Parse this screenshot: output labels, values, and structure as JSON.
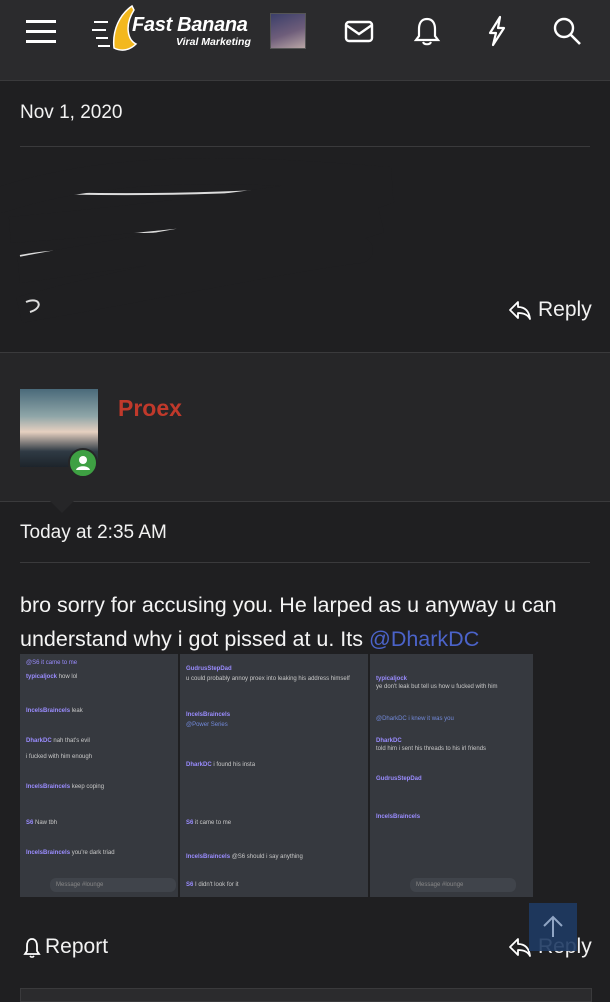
{
  "brand": {
    "name": "Fast Banana",
    "tagline": "Viral Marketing"
  },
  "icons": [
    "menu-icon",
    "avatar",
    "mail-icon",
    "bell-icon",
    "lightning-icon",
    "search-icon"
  ],
  "post1": {
    "date": "Nov 1, 2020",
    "reply_label": "Reply"
  },
  "post2": {
    "username": "Proex",
    "date": "Today at 2:35 AM",
    "body": "bro sorry for accusing you. He larped as u anyway u can understand why i got pissed at u. Its",
    "mention": "@DharkDC",
    "report_label": "Report",
    "reply_label": "Reply"
  },
  "colors": {
    "username": "#c0392b",
    "mention": "#4b63c9",
    "online": "#3ea043",
    "background": "#1f1f21"
  },
  "screenshots": [
    {
      "messages": [
        {
          "user": "typicaljock",
          "text": "how lol"
        },
        {
          "user": "IncelsBraincels",
          "text": "leak"
        },
        {
          "user": "DharkDC",
          "text": "nah that's evil"
        },
        {
          "user": "",
          "text": "i fucked with him enough"
        },
        {
          "user": "IncelsBraincels",
          "text": "keep coping"
        },
        {
          "user": "S6",
          "text": "Naw tbh"
        },
        {
          "user": "IncelsBraincels",
          "text": "you're dark triad"
        }
      ],
      "input_placeholder": "Message #lounge"
    },
    {
      "messages": [
        {
          "user": "GudrusStepDad",
          "text": "u could probably annoy proex into leaking his address himself"
        },
        {
          "user": "IncelsBraincels",
          "text": "@Power Series"
        },
        {
          "user": "DharkDC",
          "text": "i found his insta"
        },
        {
          "user": "S6",
          "text": "it came to me"
        },
        {
          "user": "IncelsBraincels",
          "text": "@S6 should i say anything"
        },
        {
          "user": "S6",
          "text": "I didn't look for it"
        }
      ],
      "input_placeholder": ""
    },
    {
      "messages": [
        {
          "user": "typicaljock",
          "text": "ye don't leak but tell us how u fucked with him"
        },
        {
          "user": "",
          "text": "@DharkDC i knew it was you"
        },
        {
          "user": "DharkDC",
          "text": "told him i sent his threads to his irl friends"
        },
        {
          "user": "GudrusStepDad",
          "text": ""
        },
        {
          "user": "IncelsBraincels",
          "text": ""
        }
      ],
      "input_placeholder": "Message #lounge"
    }
  ]
}
